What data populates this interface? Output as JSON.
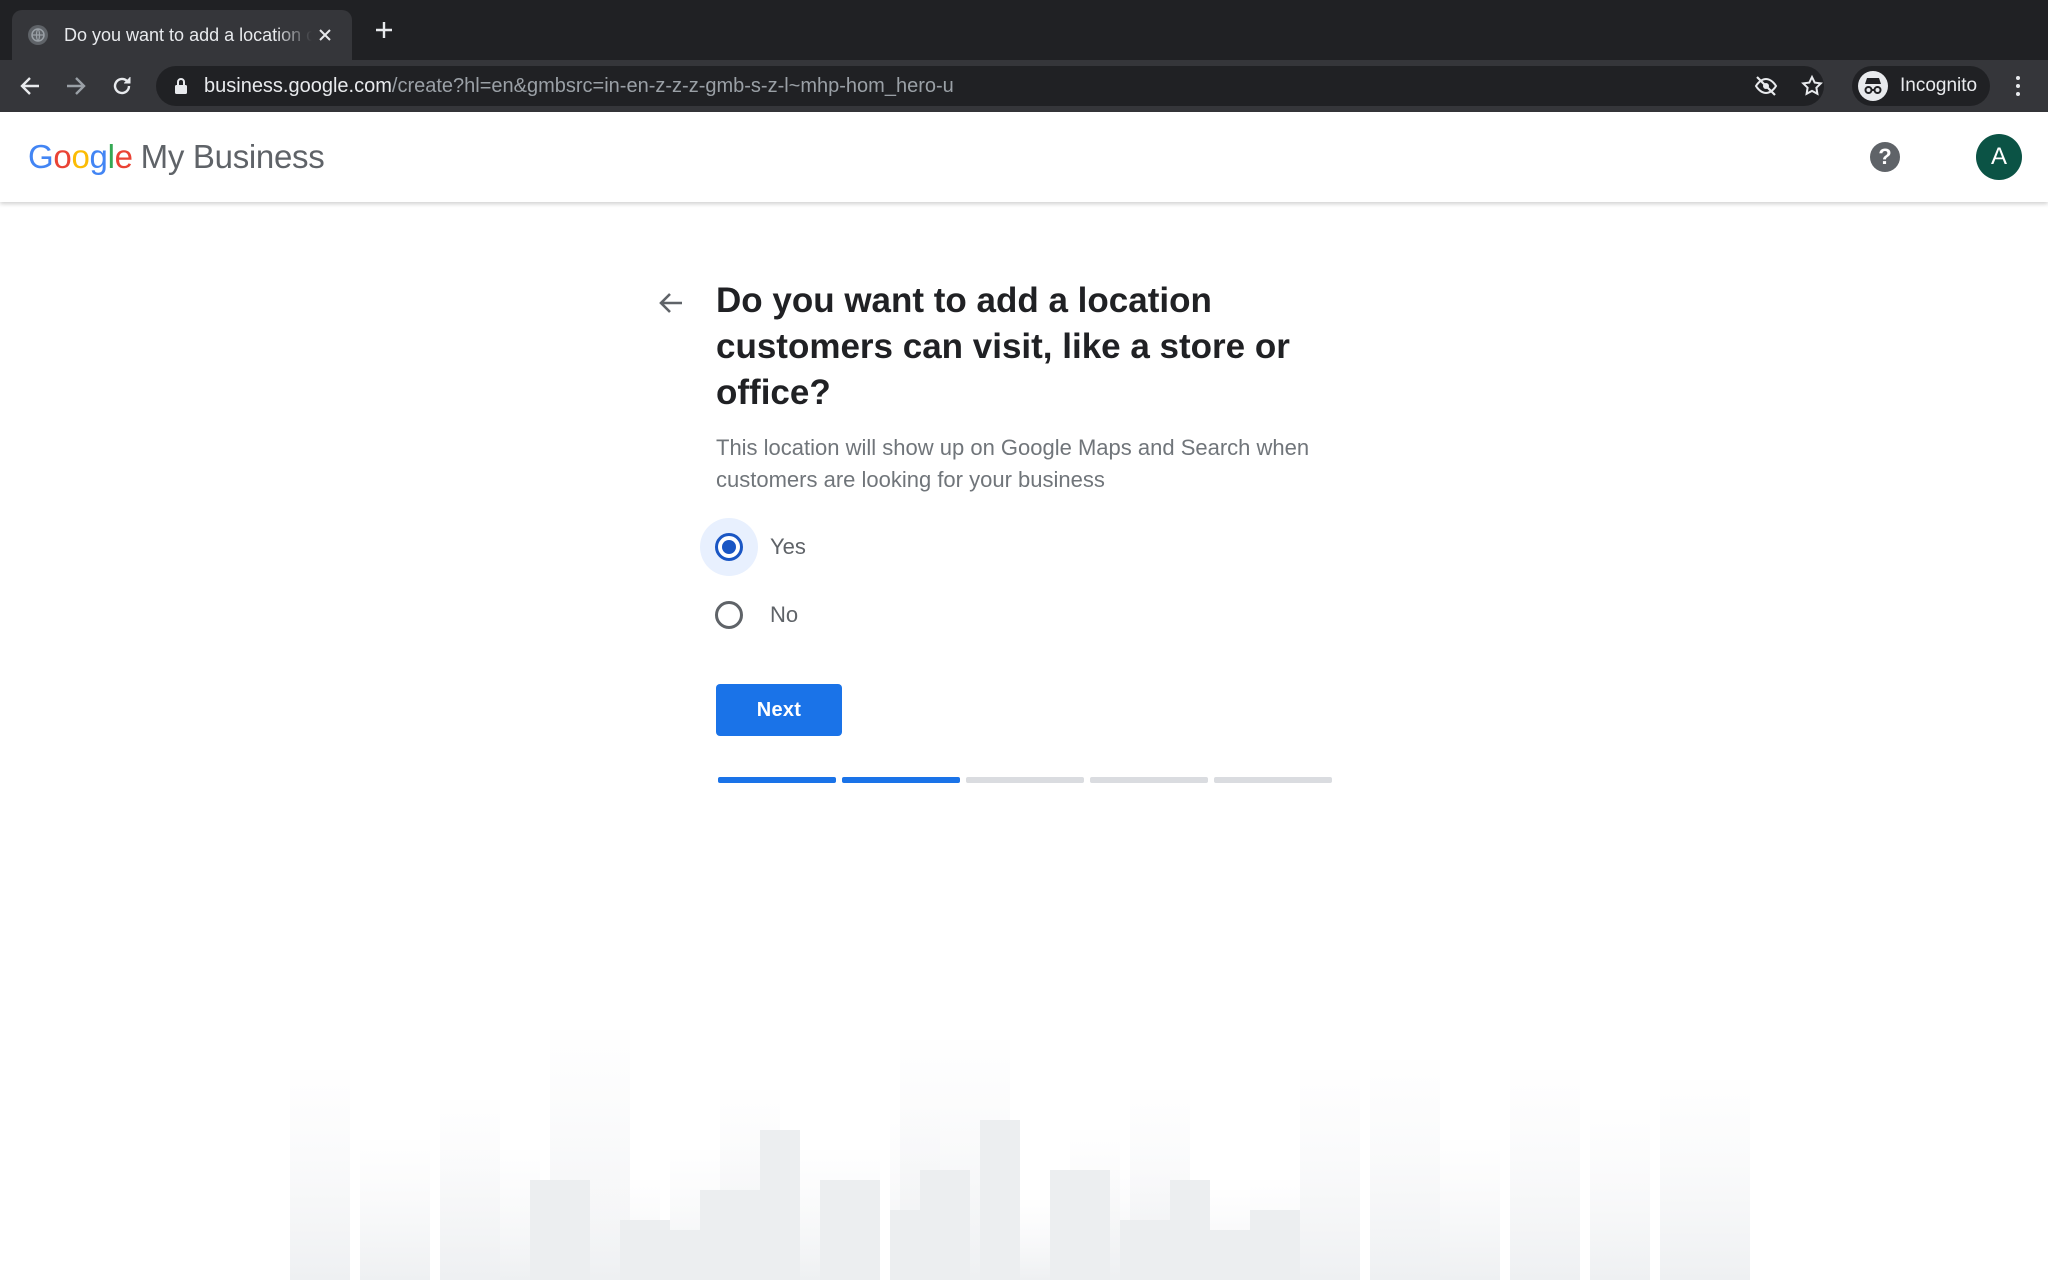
{
  "browser": {
    "tab": {
      "title": "Do you want to add a location customers can visit, like a store or office?"
    },
    "url": {
      "host": "business.google.com",
      "path": "/create?hl=en&gmbsrc=in-en-z-z-z-gmb-s-z-l~mhp-hom_hero-u"
    },
    "incognito_label": "Incognito"
  },
  "app": {
    "logo": {
      "g": "G",
      "o1": "o",
      "o2": "o",
      "g2": "g",
      "l": "l",
      "e": "e",
      "product": "My Business"
    },
    "help_icon": "?",
    "account_initial": "A"
  },
  "page": {
    "question": "Do you want to add a location customers can visit, like a store or office?",
    "description": "This location will show up on Google Maps and Search when customers are looking for your business",
    "options": [
      {
        "label": "Yes",
        "selected": true
      },
      {
        "label": "No",
        "selected": false
      }
    ],
    "next_label": "Next",
    "progress": {
      "total_steps": 5,
      "completed_steps": 2
    }
  },
  "colors": {
    "primary": "#1a73e8",
    "radio_selected": "#1a56c4",
    "account_avatar": "#0b5345"
  },
  "icons": {
    "tab_favicon": "globe-icon",
    "tab_close": "close-icon",
    "new_tab": "plus-icon",
    "back": "arrow-left-icon",
    "forward": "arrow-right-icon",
    "reload": "reload-icon",
    "lock": "lock-icon",
    "eye_off": "eye-off-icon",
    "bookmark": "star-icon",
    "incognito": "incognito-icon",
    "menu": "kebab-menu-icon",
    "help": "help-circle-icon",
    "page_back": "arrow-left-icon"
  }
}
